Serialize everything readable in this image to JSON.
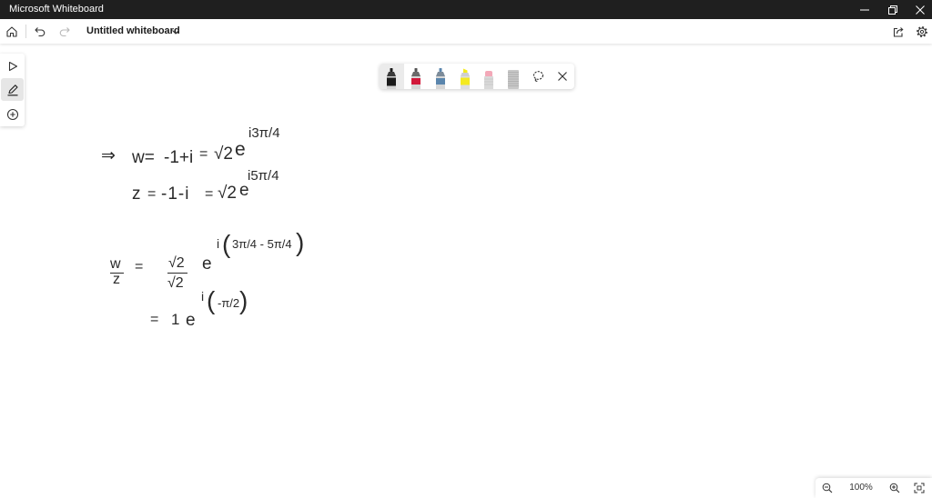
{
  "window": {
    "title": "Microsoft Whiteboard",
    "background": "#1f1f1f",
    "controls": {
      "minimize_icon": "minimize-icon",
      "restore_icon": "restore-icon",
      "close_icon": "close-icon"
    }
  },
  "app_bar": {
    "home_icon": "home-icon",
    "undo_icon": "undo-icon",
    "redo_icon": "redo-icon",
    "redo_enabled": false,
    "board_title": "Untitled whiteboard",
    "title_menu_icon": "chevron-down-icon",
    "share_icon": "share-icon",
    "settings_icon": "settings-icon"
  },
  "left_toolbar": {
    "tools": [
      {
        "icon": "select-pointer-icon",
        "selected": false
      },
      {
        "icon": "pen-icon",
        "selected": true
      },
      {
        "icon": "add-icon",
        "selected": false
      }
    ]
  },
  "ink_toolbar": {
    "tools": [
      {
        "icon": "black-pen-icon",
        "color": "#1c1c1c",
        "selected": true
      },
      {
        "icon": "red-pen-icon",
        "color": "#d2183a",
        "selected": false
      },
      {
        "icon": "blue-pen-icon",
        "color": "#5b86ad",
        "selected": false
      },
      {
        "icon": "yellow-highlighter-icon",
        "color": "#f4ea20",
        "selected": false
      },
      {
        "icon": "eraser-icon",
        "color": "#f3a8b8",
        "selected": false
      },
      {
        "icon": "ruler-icon",
        "color": "#c8c8c8",
        "selected": false
      },
      {
        "icon": "lasso-select-icon",
        "selected": false
      },
      {
        "icon": "close-icon",
        "selected": false
      }
    ]
  },
  "canvas": {
    "background": "#ffffff",
    "ink_color": "#2a2a2a",
    "ink": {
      "line1": {
        "arrow": "⇒",
        "lhs": "w=",
        "value": "-1+i",
        "eq": "=",
        "coef": "√2",
        "base": "e",
        "exponent": "i3π/4"
      },
      "line2": {
        "lhs": "z",
        "eq1": "=",
        "value": "-1-i",
        "eq2": "=",
        "coef": "√2",
        "base": "e",
        "exponent": "i5π/4"
      },
      "line3": {
        "num": "w",
        "den": "z",
        "eq": "=",
        "coef_num": "√2",
        "coef_den": "√2",
        "base": "e",
        "exp_i": "i",
        "open_paren": "(",
        "exp_body": "3π/4 - 5π/4",
        "close_paren": ")"
      },
      "line4": {
        "eq": "=",
        "coef": "1",
        "base": "e",
        "exp_i": "i",
        "open_paren": "(",
        "exp_body": "-π/2",
        "close_paren": ")"
      }
    }
  },
  "zoom": {
    "zoom_out_icon": "zoom-out-icon",
    "level": "100%",
    "zoom_in_icon": "zoom-in-icon",
    "fit_icon": "fit-to-screen-icon"
  }
}
